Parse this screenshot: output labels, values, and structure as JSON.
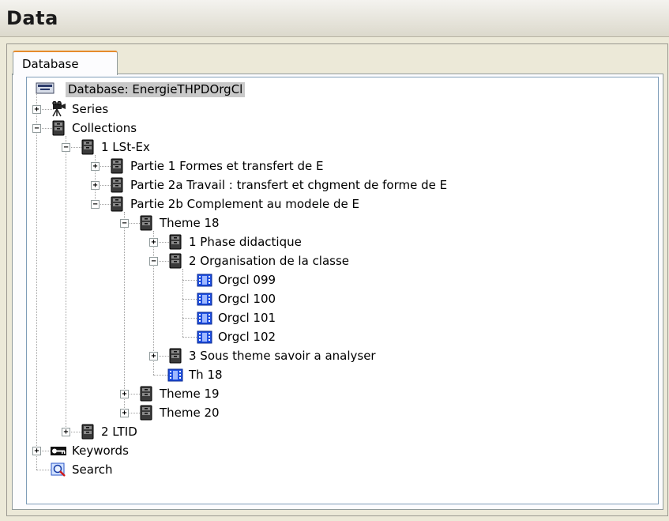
{
  "panel": {
    "title": "Data"
  },
  "tabs": [
    {
      "label": "Database",
      "active": true
    }
  ],
  "tree": {
    "root": "Database: EnergieTHPDOrgCl",
    "items": [
      {
        "label": "Series",
        "icon": "series-camera-icon",
        "expander": "+"
      },
      {
        "label": "Collections",
        "icon": "collection-cabinet-icon",
        "expander": "−"
      },
      {
        "label": "1 LSt-Ex",
        "icon": "collection-cabinet-icon",
        "expander": "−"
      },
      {
        "label": "Partie 1 Formes et transfert de E",
        "icon": "collection-cabinet-icon",
        "expander": "+"
      },
      {
        "label": "Partie 2a Travail : transfert et chgment de forme de E",
        "icon": "collection-cabinet-icon",
        "expander": "+"
      },
      {
        "label": "Partie 2b  Complement au modele de E",
        "icon": "collection-cabinet-icon",
        "expander": "−"
      },
      {
        "label": "Theme 18",
        "icon": "collection-cabinet-icon",
        "expander": "−"
      },
      {
        "label": "1 Phase didactique",
        "icon": "collection-cabinet-icon",
        "expander": "+"
      },
      {
        "label": "2 Organisation de la classe",
        "icon": "collection-cabinet-icon",
        "expander": "−"
      },
      {
        "label": "Orgcl 099",
        "icon": "video-film-icon",
        "expander": ""
      },
      {
        "label": "Orgcl 100",
        "icon": "video-film-icon",
        "expander": ""
      },
      {
        "label": "Orgcl 101",
        "icon": "video-film-icon",
        "expander": ""
      },
      {
        "label": "Orgcl 102",
        "icon": "video-film-icon",
        "expander": ""
      },
      {
        "label": "3 Sous theme savoir a analyser",
        "icon": "collection-cabinet-icon",
        "expander": "+"
      },
      {
        "label": "Th 18",
        "icon": "video-film-icon",
        "expander": ""
      },
      {
        "label": "Theme 19",
        "icon": "collection-cabinet-icon",
        "expander": "+"
      },
      {
        "label": "Theme 20",
        "icon": "collection-cabinet-icon",
        "expander": "+"
      },
      {
        "label": "2 LTID",
        "icon": "collection-cabinet-icon",
        "expander": "+"
      },
      {
        "label": "Keywords",
        "icon": "keywords-icon",
        "expander": "+"
      },
      {
        "label": "Search",
        "icon": "search-magnifier-icon",
        "expander": ""
      }
    ]
  },
  "colors": {
    "tab_accent": "#e68b2c",
    "selection": "#c9c9c9",
    "film_blue": "#1f4fe0",
    "cabinet": "#2b2b2b"
  }
}
